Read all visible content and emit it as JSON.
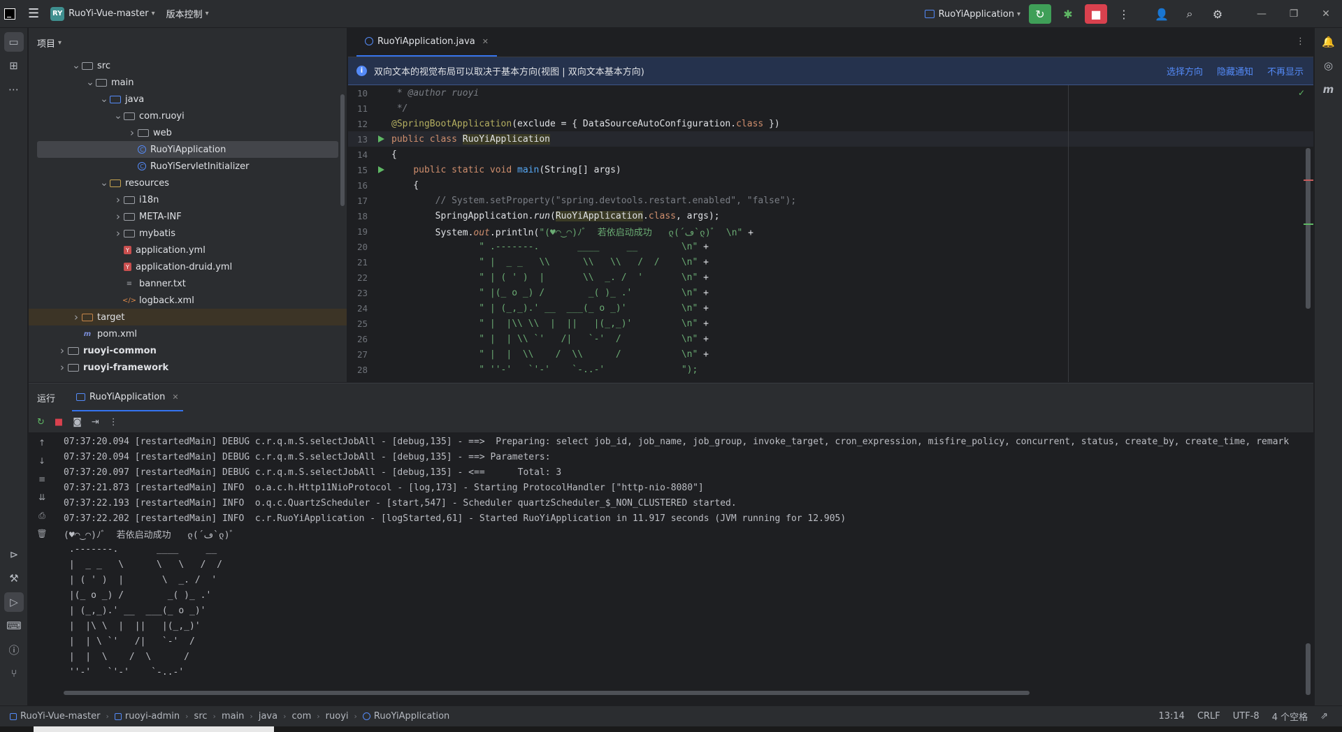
{
  "titlebar": {
    "project_badge": "RY",
    "project_name": "RuoYi-Vue-master",
    "vcs_menu": "版本控制",
    "run_config": "RuoYiApplication"
  },
  "project_panel": {
    "title": "项目",
    "tree": [
      {
        "label": "src",
        "depth": 2,
        "type": "folder",
        "arrow": "down"
      },
      {
        "label": "main",
        "depth": 3,
        "type": "folder",
        "arrow": "down"
      },
      {
        "label": "java",
        "depth": 4,
        "type": "folder-blue",
        "arrow": "down"
      },
      {
        "label": "com.ruoyi",
        "depth": 5,
        "type": "package",
        "arrow": "down"
      },
      {
        "label": "web",
        "depth": 6,
        "type": "package",
        "arrow": "right"
      },
      {
        "label": "RuoYiApplication",
        "depth": 6,
        "type": "class",
        "arrow": "",
        "selected": true
      },
      {
        "label": "RuoYiServletInitializer",
        "depth": 6,
        "type": "class",
        "arrow": ""
      },
      {
        "label": "resources",
        "depth": 4,
        "type": "folder-res",
        "arrow": "down"
      },
      {
        "label": "i18n",
        "depth": 5,
        "type": "folder",
        "arrow": "right"
      },
      {
        "label": "META-INF",
        "depth": 5,
        "type": "folder",
        "arrow": "right"
      },
      {
        "label": "mybatis",
        "depth": 5,
        "type": "folder",
        "arrow": "right"
      },
      {
        "label": "application.yml",
        "depth": 5,
        "type": "yml",
        "arrow": ""
      },
      {
        "label": "application-druid.yml",
        "depth": 5,
        "type": "yml",
        "arrow": ""
      },
      {
        "label": "banner.txt",
        "depth": 5,
        "type": "txt",
        "arrow": ""
      },
      {
        "label": "logback.xml",
        "depth": 5,
        "type": "xml",
        "arrow": ""
      },
      {
        "label": "target",
        "depth": 2,
        "type": "folder-orange",
        "arrow": "right",
        "excluded": true
      },
      {
        "label": "pom.xml",
        "depth": 2,
        "type": "maven",
        "arrow": ""
      },
      {
        "label": "ruoyi-common",
        "depth": 1,
        "type": "module",
        "arrow": "right",
        "bold": true
      },
      {
        "label": "ruoyi-framework",
        "depth": 1,
        "type": "module",
        "arrow": "right",
        "bold": true
      }
    ]
  },
  "editor": {
    "tab_label": "RuoYiApplication.java",
    "notice_text": "双向文本的视觉布局可以取决于基本方向(视图 | 双向文本基本方向)",
    "notice_actions": [
      "选择方向",
      "隐藏通知",
      "不再显示"
    ],
    "lines": [
      {
        "n": "10",
        "html": "<span class='cm it'> * </span><span class='cm it ann'>@author</span><span class='cm it'> ruoyi</span>"
      },
      {
        "n": "11",
        "html": "<span class='cm it'> */</span>"
      },
      {
        "n": "12",
        "html": "<span class='ann'>@SpringBootApplication</span>(exclude = { DataSourceAutoConfiguration.<span class='kw'>class</span> })"
      },
      {
        "n": "13",
        "run": true,
        "cur": true,
        "html": "<span class='kw'>public class </span><span class='hl'>RuoYiApplication</span>"
      },
      {
        "n": "14",
        "html": "{"
      },
      {
        "n": "15",
        "run": true,
        "html": "    <span class='kw'>public static void </span><span class='fn'>main</span>(String[] args)"
      },
      {
        "n": "16",
        "html": "    {"
      },
      {
        "n": "17",
        "html": "        <span class='cm'>// System.setProperty(\"spring.devtools.restart.enabled\", \"false\");</span>"
      },
      {
        "n": "18",
        "html": "        SpringApplication.<span class='it'>run</span>(<span class='hl'>RuoYiApplication</span>.<span class='kw'>class</span>, args);"
      },
      {
        "n": "19",
        "html": "        System.<span class='kw it'>out</span>.println(<span class='str'>\"(♥◠‿◠)ﾉﾞ  若依启动成功   ლ(´ڡ`ლ)ﾞ  \\n\"</span> +"
      },
      {
        "n": "20",
        "html": "                <span class='str'>\" .-------.       ____     __        \\n\"</span> +"
      },
      {
        "n": "21",
        "html": "                <span class='str'>\" |  _ _   \\\\      \\\\   \\\\   /  /    \\n\"</span> +"
      },
      {
        "n": "22",
        "html": "                <span class='str'>\" | ( ' )  |       \\\\  _. /  '       \\n\"</span> +"
      },
      {
        "n": "23",
        "html": "                <span class='str'>\" |(_ o _) /        _( )_ .'         \\n\"</span> +"
      },
      {
        "n": "24",
        "html": "                <span class='str'>\" | (_,_).' __  ___(_ o _)'          \\n\"</span> +"
      },
      {
        "n": "25",
        "html": "                <span class='str'>\" |  |\\\\ \\\\  |  ||   |(_,_)'         \\n\"</span> +"
      },
      {
        "n": "26",
        "html": "                <span class='str'>\" |  | \\\\ `'   /|   `-'  /           \\n\"</span> +"
      },
      {
        "n": "27",
        "html": "                <span class='str'>\" |  |  \\\\    /  \\\\      /           \\n\"</span> +"
      },
      {
        "n": "28",
        "html": "                <span class='str'>\" ''-'   `'-'    `-..-'              \");</span>"
      }
    ]
  },
  "run_panel": {
    "title": "运行",
    "tab_label": "RuoYiApplication",
    "console": [
      "07:37:20.094 [restartedMain] DEBUG c.r.q.m.S.selectJobAll - [debug,135] - ==>  Preparing: select job_id, job_name, job_group, invoke_target, cron_expression, misfire_policy, concurrent, status, create_by, create_time, remark",
      "07:37:20.094 [restartedMain] DEBUG c.r.q.m.S.selectJobAll - [debug,135] - ==> Parameters: ",
      "07:37:20.097 [restartedMain] DEBUG c.r.q.m.S.selectJobAll - [debug,135] - <==      Total: 3",
      "07:37:21.873 [restartedMain] INFO  o.a.c.h.Http11NioProtocol - [log,173] - Starting ProtocolHandler [\"http-nio-8080\"]",
      "07:37:22.193 [restartedMain] INFO  o.q.c.QuartzScheduler - [start,547] - Scheduler quartzScheduler_$_NON_CLUSTERED started.",
      "07:37:22.202 [restartedMain] INFO  c.r.RuoYiApplication - [logStarted,61] - Started RuoYiApplication in 11.917 seconds (JVM running for 12.905)",
      "(♥◠‿◠)ﾉﾞ  若依启动成功   ლ(´ڡ`ლ)ﾞ",
      " .-------.       ____     __",
      " |  _ _   \\      \\   \\   /  /",
      " | ( ' )  |       \\  _. /  '",
      " |(_ o _) /        _( )_ .'",
      " | (_,_).' __  ___(_ o _)'",
      " |  |\\ \\  |  ||   |(_,_)'",
      " |  | \\ `'   /|   `-'  /",
      " |  |  \\    /  \\      /",
      " ''-'   `'-'    `-..-'"
    ]
  },
  "statusbar": {
    "breadcrumbs": [
      "RuoYi-Vue-master",
      "ruoyi-admin",
      "src",
      "main",
      "java",
      "com",
      "ruoyi",
      "RuoYiApplication"
    ],
    "position": "13:14",
    "line_sep": "CRLF",
    "encoding": "UTF-8",
    "indent": "4 个空格"
  }
}
